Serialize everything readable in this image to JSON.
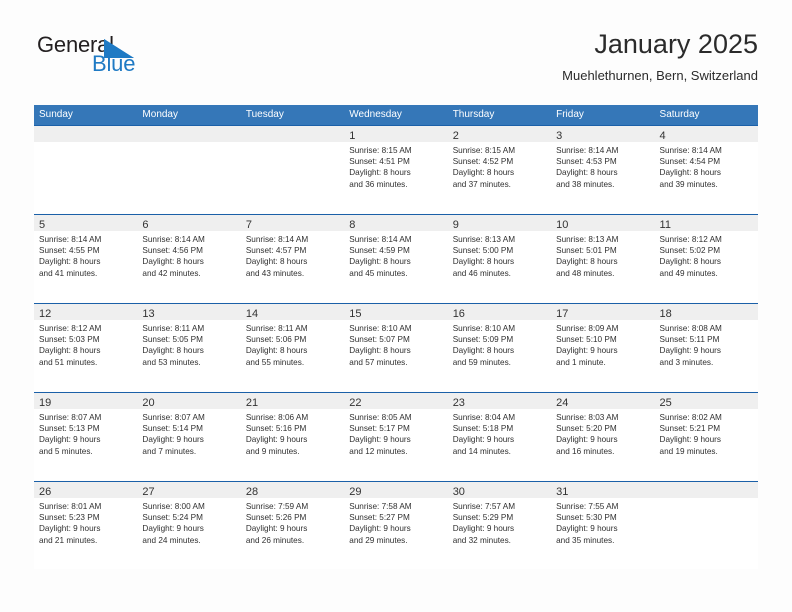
{
  "logo": {
    "text_top": "General",
    "text_bottom": "Blue",
    "triangle_icon": "triangle-icon",
    "blue": "#1f7ac4",
    "dark": "#231f20"
  },
  "header": {
    "title": "January 2025",
    "subtitle": "Muehlethurnen, Bern, Switzerland"
  },
  "theme": {
    "header_blue": "#3577b8",
    "row_line_blue": "#1b60a8",
    "day_band_gray": "#efefef"
  },
  "weekdays": [
    "Sunday",
    "Monday",
    "Tuesday",
    "Wednesday",
    "Thursday",
    "Friday",
    "Saturday"
  ],
  "weeks": [
    [
      {
        "day": "",
        "sunrise": "",
        "sunset": "",
        "daylight_1": "",
        "daylight_2": ""
      },
      {
        "day": "",
        "sunrise": "",
        "sunset": "",
        "daylight_1": "",
        "daylight_2": ""
      },
      {
        "day": "",
        "sunrise": "",
        "sunset": "",
        "daylight_1": "",
        "daylight_2": ""
      },
      {
        "day": "1",
        "sunrise": "Sunrise: 8:15 AM",
        "sunset": "Sunset: 4:51 PM",
        "daylight_1": "Daylight: 8 hours",
        "daylight_2": "and 36 minutes."
      },
      {
        "day": "2",
        "sunrise": "Sunrise: 8:15 AM",
        "sunset": "Sunset: 4:52 PM",
        "daylight_1": "Daylight: 8 hours",
        "daylight_2": "and 37 minutes."
      },
      {
        "day": "3",
        "sunrise": "Sunrise: 8:14 AM",
        "sunset": "Sunset: 4:53 PM",
        "daylight_1": "Daylight: 8 hours",
        "daylight_2": "and 38 minutes."
      },
      {
        "day": "4",
        "sunrise": "Sunrise: 8:14 AM",
        "sunset": "Sunset: 4:54 PM",
        "daylight_1": "Daylight: 8 hours",
        "daylight_2": "and 39 minutes."
      }
    ],
    [
      {
        "day": "5",
        "sunrise": "Sunrise: 8:14 AM",
        "sunset": "Sunset: 4:55 PM",
        "daylight_1": "Daylight: 8 hours",
        "daylight_2": "and 41 minutes."
      },
      {
        "day": "6",
        "sunrise": "Sunrise: 8:14 AM",
        "sunset": "Sunset: 4:56 PM",
        "daylight_1": "Daylight: 8 hours",
        "daylight_2": "and 42 minutes."
      },
      {
        "day": "7",
        "sunrise": "Sunrise: 8:14 AM",
        "sunset": "Sunset: 4:57 PM",
        "daylight_1": "Daylight: 8 hours",
        "daylight_2": "and 43 minutes."
      },
      {
        "day": "8",
        "sunrise": "Sunrise: 8:14 AM",
        "sunset": "Sunset: 4:59 PM",
        "daylight_1": "Daylight: 8 hours",
        "daylight_2": "and 45 minutes."
      },
      {
        "day": "9",
        "sunrise": "Sunrise: 8:13 AM",
        "sunset": "Sunset: 5:00 PM",
        "daylight_1": "Daylight: 8 hours",
        "daylight_2": "and 46 minutes."
      },
      {
        "day": "10",
        "sunrise": "Sunrise: 8:13 AM",
        "sunset": "Sunset: 5:01 PM",
        "daylight_1": "Daylight: 8 hours",
        "daylight_2": "and 48 minutes."
      },
      {
        "day": "11",
        "sunrise": "Sunrise: 8:12 AM",
        "sunset": "Sunset: 5:02 PM",
        "daylight_1": "Daylight: 8 hours",
        "daylight_2": "and 49 minutes."
      }
    ],
    [
      {
        "day": "12",
        "sunrise": "Sunrise: 8:12 AM",
        "sunset": "Sunset: 5:03 PM",
        "daylight_1": "Daylight: 8 hours",
        "daylight_2": "and 51 minutes."
      },
      {
        "day": "13",
        "sunrise": "Sunrise: 8:11 AM",
        "sunset": "Sunset: 5:05 PM",
        "daylight_1": "Daylight: 8 hours",
        "daylight_2": "and 53 minutes."
      },
      {
        "day": "14",
        "sunrise": "Sunrise: 8:11 AM",
        "sunset": "Sunset: 5:06 PM",
        "daylight_1": "Daylight: 8 hours",
        "daylight_2": "and 55 minutes."
      },
      {
        "day": "15",
        "sunrise": "Sunrise: 8:10 AM",
        "sunset": "Sunset: 5:07 PM",
        "daylight_1": "Daylight: 8 hours",
        "daylight_2": "and 57 minutes."
      },
      {
        "day": "16",
        "sunrise": "Sunrise: 8:10 AM",
        "sunset": "Sunset: 5:09 PM",
        "daylight_1": "Daylight: 8 hours",
        "daylight_2": "and 59 minutes."
      },
      {
        "day": "17",
        "sunrise": "Sunrise: 8:09 AM",
        "sunset": "Sunset: 5:10 PM",
        "daylight_1": "Daylight: 9 hours",
        "daylight_2": "and 1 minute."
      },
      {
        "day": "18",
        "sunrise": "Sunrise: 8:08 AM",
        "sunset": "Sunset: 5:11 PM",
        "daylight_1": "Daylight: 9 hours",
        "daylight_2": "and 3 minutes."
      }
    ],
    [
      {
        "day": "19",
        "sunrise": "Sunrise: 8:07 AM",
        "sunset": "Sunset: 5:13 PM",
        "daylight_1": "Daylight: 9 hours",
        "daylight_2": "and 5 minutes."
      },
      {
        "day": "20",
        "sunrise": "Sunrise: 8:07 AM",
        "sunset": "Sunset: 5:14 PM",
        "daylight_1": "Daylight: 9 hours",
        "daylight_2": "and 7 minutes."
      },
      {
        "day": "21",
        "sunrise": "Sunrise: 8:06 AM",
        "sunset": "Sunset: 5:16 PM",
        "daylight_1": "Daylight: 9 hours",
        "daylight_2": "and 9 minutes."
      },
      {
        "day": "22",
        "sunrise": "Sunrise: 8:05 AM",
        "sunset": "Sunset: 5:17 PM",
        "daylight_1": "Daylight: 9 hours",
        "daylight_2": "and 12 minutes."
      },
      {
        "day": "23",
        "sunrise": "Sunrise: 8:04 AM",
        "sunset": "Sunset: 5:18 PM",
        "daylight_1": "Daylight: 9 hours",
        "daylight_2": "and 14 minutes."
      },
      {
        "day": "24",
        "sunrise": "Sunrise: 8:03 AM",
        "sunset": "Sunset: 5:20 PM",
        "daylight_1": "Daylight: 9 hours",
        "daylight_2": "and 16 minutes."
      },
      {
        "day": "25",
        "sunrise": "Sunrise: 8:02 AM",
        "sunset": "Sunset: 5:21 PM",
        "daylight_1": "Daylight: 9 hours",
        "daylight_2": "and 19 minutes."
      }
    ],
    [
      {
        "day": "26",
        "sunrise": "Sunrise: 8:01 AM",
        "sunset": "Sunset: 5:23 PM",
        "daylight_1": "Daylight: 9 hours",
        "daylight_2": "and 21 minutes."
      },
      {
        "day": "27",
        "sunrise": "Sunrise: 8:00 AM",
        "sunset": "Sunset: 5:24 PM",
        "daylight_1": "Daylight: 9 hours",
        "daylight_2": "and 24 minutes."
      },
      {
        "day": "28",
        "sunrise": "Sunrise: 7:59 AM",
        "sunset": "Sunset: 5:26 PM",
        "daylight_1": "Daylight: 9 hours",
        "daylight_2": "and 26 minutes."
      },
      {
        "day": "29",
        "sunrise": "Sunrise: 7:58 AM",
        "sunset": "Sunset: 5:27 PM",
        "daylight_1": "Daylight: 9 hours",
        "daylight_2": "and 29 minutes."
      },
      {
        "day": "30",
        "sunrise": "Sunrise: 7:57 AM",
        "sunset": "Sunset: 5:29 PM",
        "daylight_1": "Daylight: 9 hours",
        "daylight_2": "and 32 minutes."
      },
      {
        "day": "31",
        "sunrise": "Sunrise: 7:55 AM",
        "sunset": "Sunset: 5:30 PM",
        "daylight_1": "Daylight: 9 hours",
        "daylight_2": "and 35 minutes."
      },
      {
        "day": "",
        "sunrise": "",
        "sunset": "",
        "daylight_1": "",
        "daylight_2": ""
      }
    ]
  ]
}
